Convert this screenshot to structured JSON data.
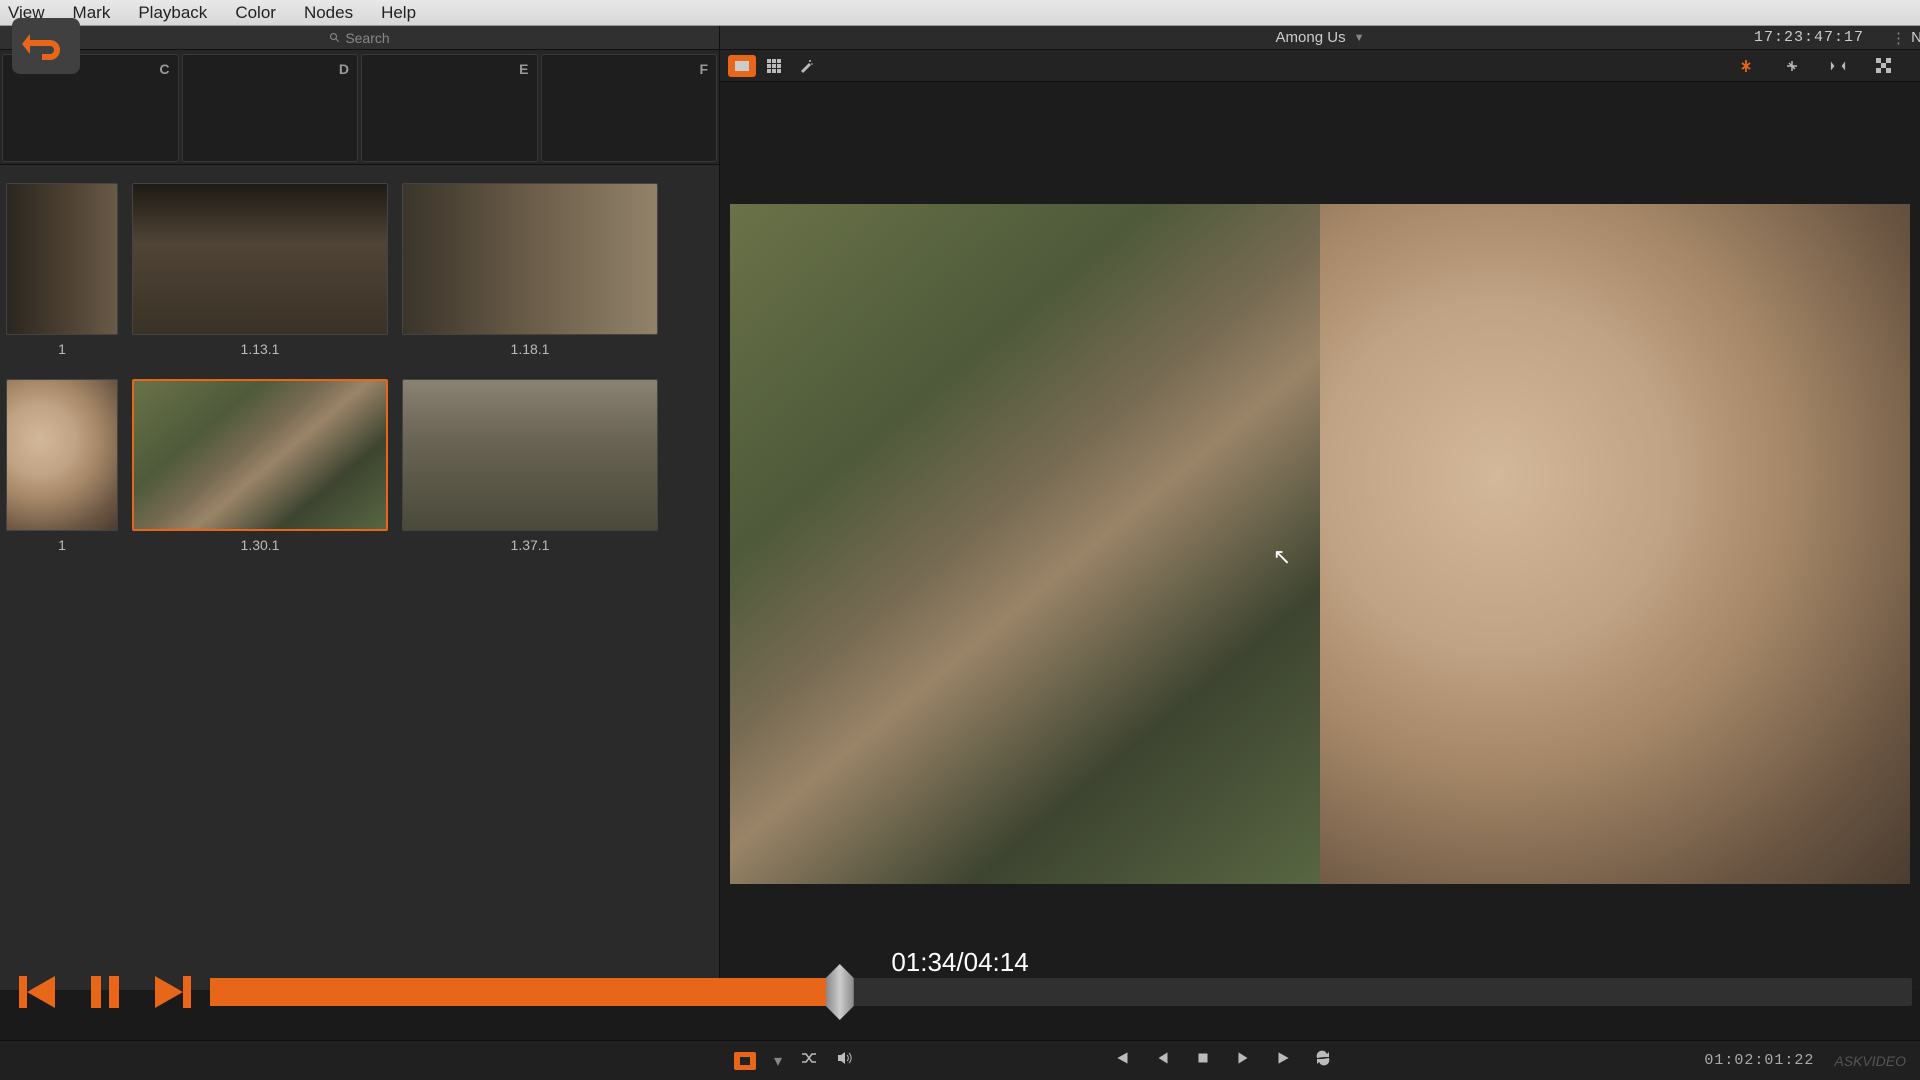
{
  "menubar": {
    "items": [
      "View",
      "Mark",
      "Playback",
      "Color",
      "Nodes",
      "Help"
    ]
  },
  "search": {
    "placeholder": "Search"
  },
  "bins": {
    "letters": [
      "C",
      "D",
      "E",
      "F"
    ]
  },
  "clips": {
    "row1": [
      {
        "label": "1",
        "narrow": true,
        "scene": "scene-bus"
      },
      {
        "label": "1.13.1",
        "scene": "scene-hat"
      },
      {
        "label": "1.18.1",
        "scene": "scene-profile"
      }
    ],
    "row2": [
      {
        "label": "1",
        "narrow": true,
        "scene": "scene-face"
      },
      {
        "label": "1.30.1",
        "scene": "scene-picnic",
        "selected": true
      },
      {
        "label": "1.37.1",
        "scene": "scene-rocks"
      }
    ]
  },
  "viewer": {
    "title": "Among Us",
    "timecode": "17:23:47:17",
    "right_label": "N"
  },
  "player": {
    "position": "01:34",
    "duration": "04:14",
    "combined": "01:34/04:14"
  },
  "bottom": {
    "timecode": "01:02:01:22",
    "watermark": "ASKVIDEO"
  }
}
